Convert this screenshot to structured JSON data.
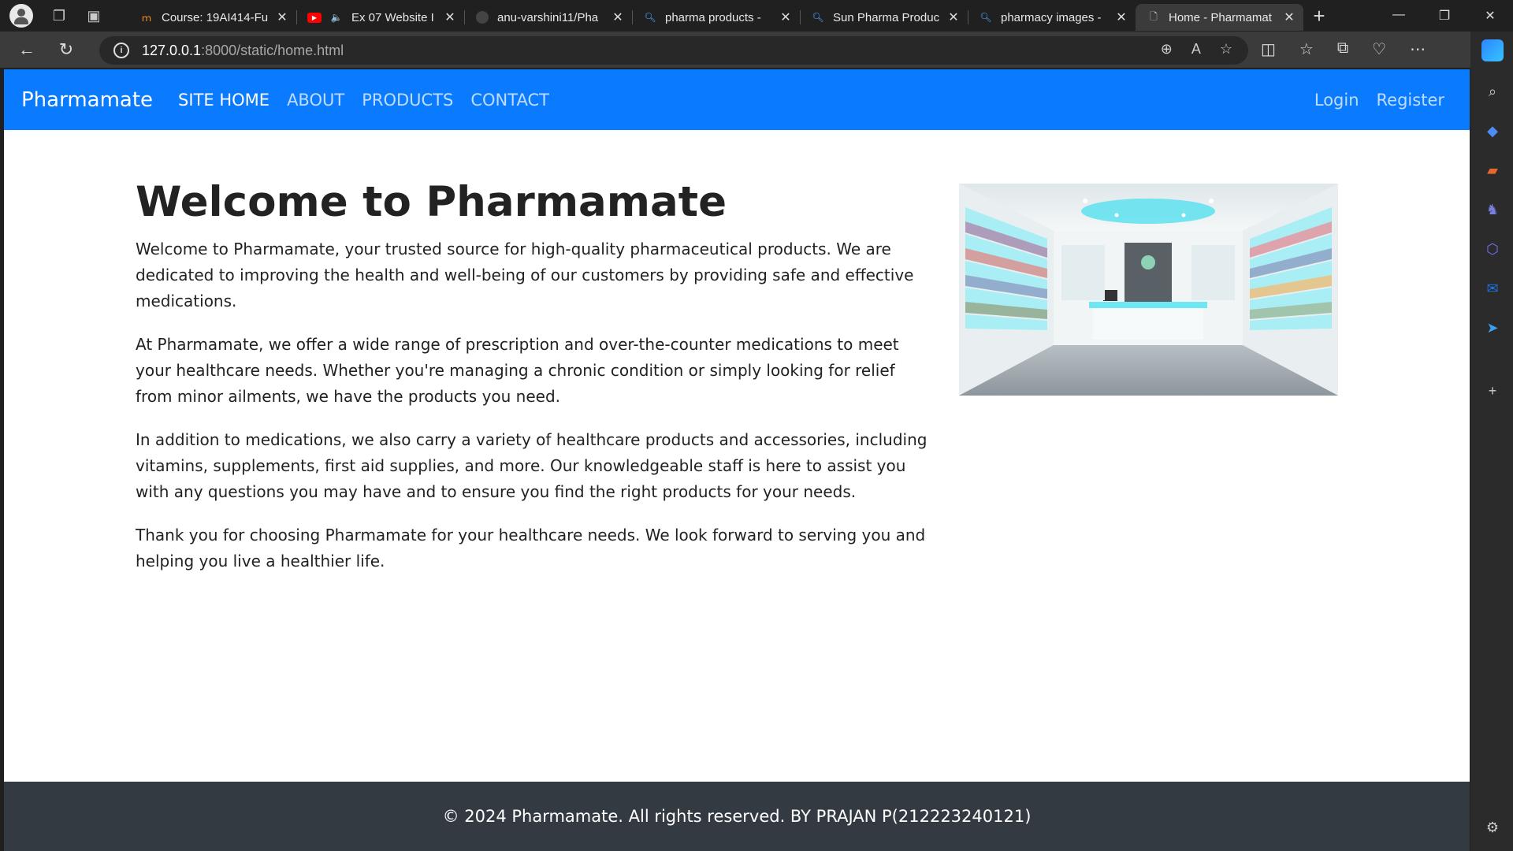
{
  "browser": {
    "tabs": [
      {
        "title": "Course: 19AI414-Fu",
        "favicon": "moodle-icon"
      },
      {
        "title": "Ex 07 Website I",
        "favicon": "youtube-icon"
      },
      {
        "title": "anu-varshini11/Pha",
        "favicon": "github-icon"
      },
      {
        "title": "pharma products - ",
        "favicon": "search-icon"
      },
      {
        "title": "Sun Pharma Produc",
        "favicon": "search-icon"
      },
      {
        "title": "pharmacy images - ",
        "favicon": "search-icon"
      },
      {
        "title": "Home - Pharmamat",
        "favicon": "page-icon",
        "active": true
      }
    ],
    "url_host": "127.0.0.1",
    "url_rest": ":8000/static/home.html"
  },
  "site": {
    "brand": "Pharmamate",
    "nav": [
      "SITE HOME",
      "ABOUT",
      "PRODUCTS",
      "CONTACT"
    ],
    "auth": [
      "Login",
      "Register"
    ]
  },
  "main": {
    "heading": "Welcome to Pharmamate",
    "paragraphs": [
      "Welcome to Pharmamate, your trusted source for high-quality pharmaceutical products. We are dedicated to improving the health and well-being of our customers by providing safe and effective medications.",
      "At Pharmamate, we offer a wide range of prescription and over-the-counter medications to meet your healthcare needs. Whether you're managing a chronic condition or simply looking for relief from minor ailments, we have the products you need.",
      "In addition to medications, we also carry a variety of healthcare products and accessories, including vitamins, supplements, first aid supplies, and more. Our knowledgeable staff is here to assist you with any questions you may have and to ensure you find the right products for your needs.",
      "Thank you for choosing Pharmamate for your healthcare needs. We look forward to serving you and helping you live a healthier life."
    ]
  },
  "footer": {
    "text": "© 2024 Pharmamate. All rights reserved. BY PRAJAN P(212223240121)"
  },
  "colors": {
    "navbar": "#0a7bff",
    "footer": "#333a41"
  }
}
